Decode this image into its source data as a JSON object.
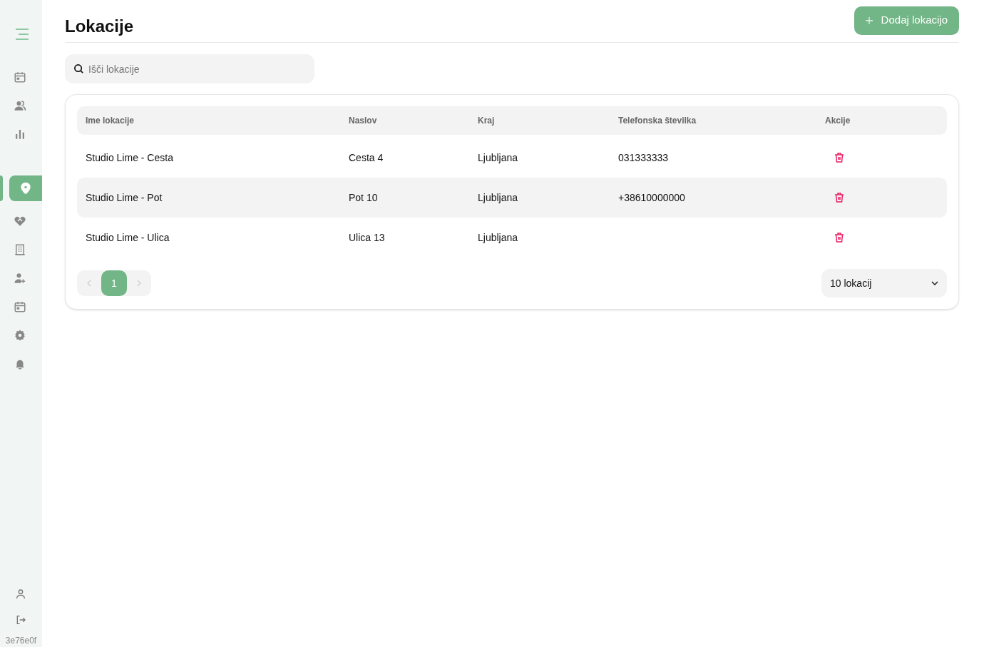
{
  "sidebar": {
    "groups": [
      [
        {
          "kind": "calendar",
          "selected": false
        },
        {
          "kind": "users",
          "selected": false
        },
        {
          "kind": "chart",
          "selected": false
        }
      ],
      [
        {
          "kind": "pin",
          "selected": true
        },
        {
          "kind": "heart",
          "selected": false
        },
        {
          "kind": "building",
          "selected": false
        },
        {
          "kind": "user-plus",
          "selected": false
        },
        {
          "kind": "calendar",
          "selected": false
        },
        {
          "kind": "gear",
          "selected": false
        },
        {
          "kind": "bell",
          "selected": false
        }
      ]
    ],
    "bottom": [
      {
        "kind": "user"
      },
      {
        "kind": "logout"
      }
    ],
    "version": "3e76e0f"
  },
  "page": {
    "title": "Lokacije",
    "add_button": "Dodaj lokacijo"
  },
  "search": {
    "placeholder": "Išči lokacije"
  },
  "table": {
    "columns": [
      "Ime lokacije",
      "Naslov",
      "Kraj",
      "Telefonska številka",
      "Akcije"
    ],
    "rows": [
      {
        "cells": [
          "Studio Lime - Cesta",
          "Cesta 4",
          "Ljubljana",
          "031333333"
        ],
        "highlighted": false
      },
      {
        "cells": [
          "Studio Lime - Pot",
          "Pot 10",
          "Ljubljana",
          "+38610000000"
        ],
        "highlighted": true
      },
      {
        "cells": [
          "Studio Lime - Ulica",
          "Ulica 13",
          "Ljubljana",
          ""
        ],
        "highlighted": false
      }
    ]
  },
  "pagination": {
    "pages": [
      {
        "label": "1",
        "selected": true
      }
    ],
    "page_size": "10 lokacij"
  }
}
